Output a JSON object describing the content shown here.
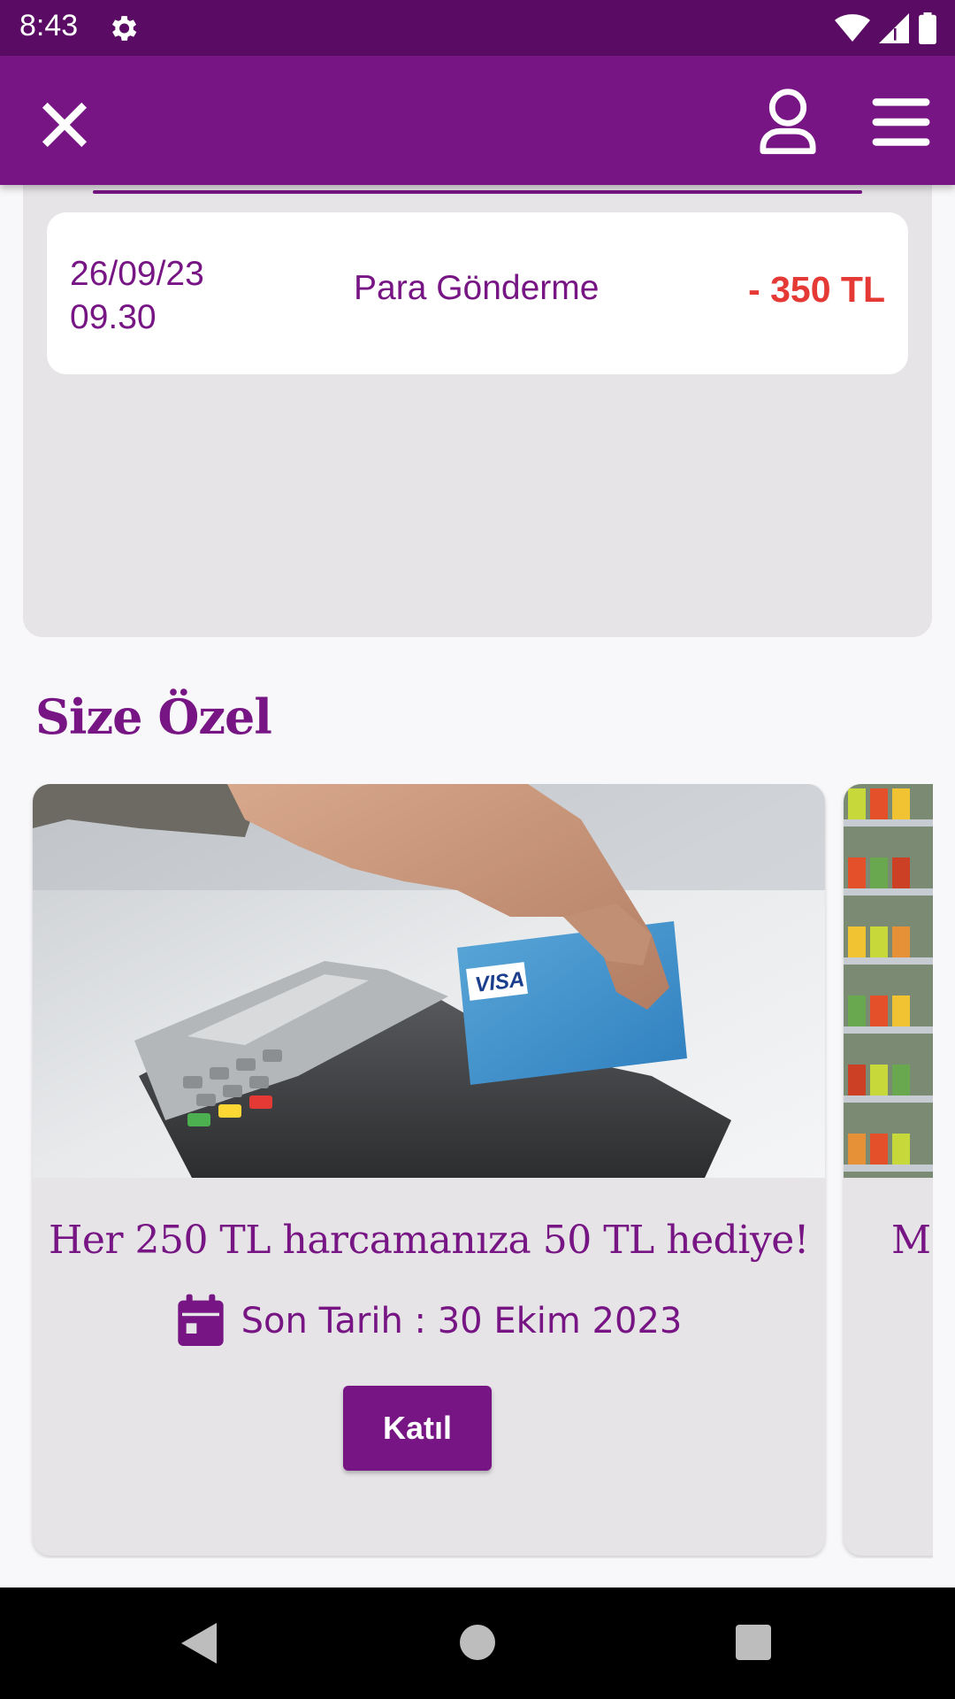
{
  "status_bar": {
    "time": "8:43"
  },
  "transaction": {
    "date": "26/09/23",
    "time": "09.30",
    "title": "Para Gönderme",
    "amount": "- 350 TL"
  },
  "section": {
    "title": "Size Özel"
  },
  "campaigns": [
    {
      "title": "Her 250 TL harcamanıza 50 TL hediye!",
      "deadline": "Son Tarih : 30 Ekim 2023",
      "button_label": "Katıl"
    },
    {
      "title": "M"
    }
  ],
  "colors": {
    "primary": "#761583",
    "status_bar": "#5a0c64",
    "amount_negative": "#e53935"
  },
  "icons": [
    "gear-icon",
    "wifi-icon",
    "signal-icon",
    "battery-icon",
    "close-icon",
    "profile-icon",
    "menu-icon",
    "calendar-icon",
    "back-icon",
    "home-icon",
    "recent-apps-icon"
  ]
}
